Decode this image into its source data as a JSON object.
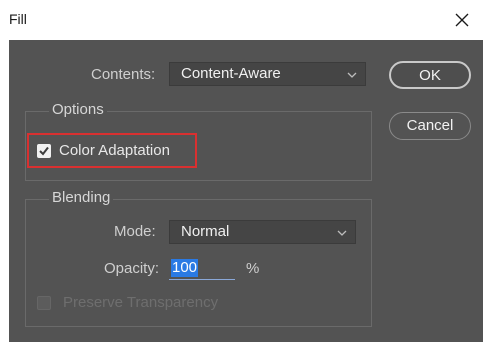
{
  "window": {
    "title": "Fill"
  },
  "contents": {
    "label": "Contents:",
    "value": "Content-Aware"
  },
  "buttons": {
    "ok": "OK",
    "cancel": "Cancel"
  },
  "options": {
    "group_title": "Options",
    "color_adaptation": {
      "label": "Color Adaptation",
      "checked": true
    }
  },
  "blending": {
    "group_title": "Blending",
    "mode_label": "Mode:",
    "mode_value": "Normal",
    "opacity_label": "Opacity:",
    "opacity_value": "100",
    "opacity_unit": "%",
    "preserve_transparency": {
      "label": "Preserve Transparency",
      "checked": false,
      "disabled": true
    }
  },
  "colors": {
    "dialog_bg": "#535353",
    "highlight_border": "#d93030",
    "selection": "#2a7ae4"
  }
}
